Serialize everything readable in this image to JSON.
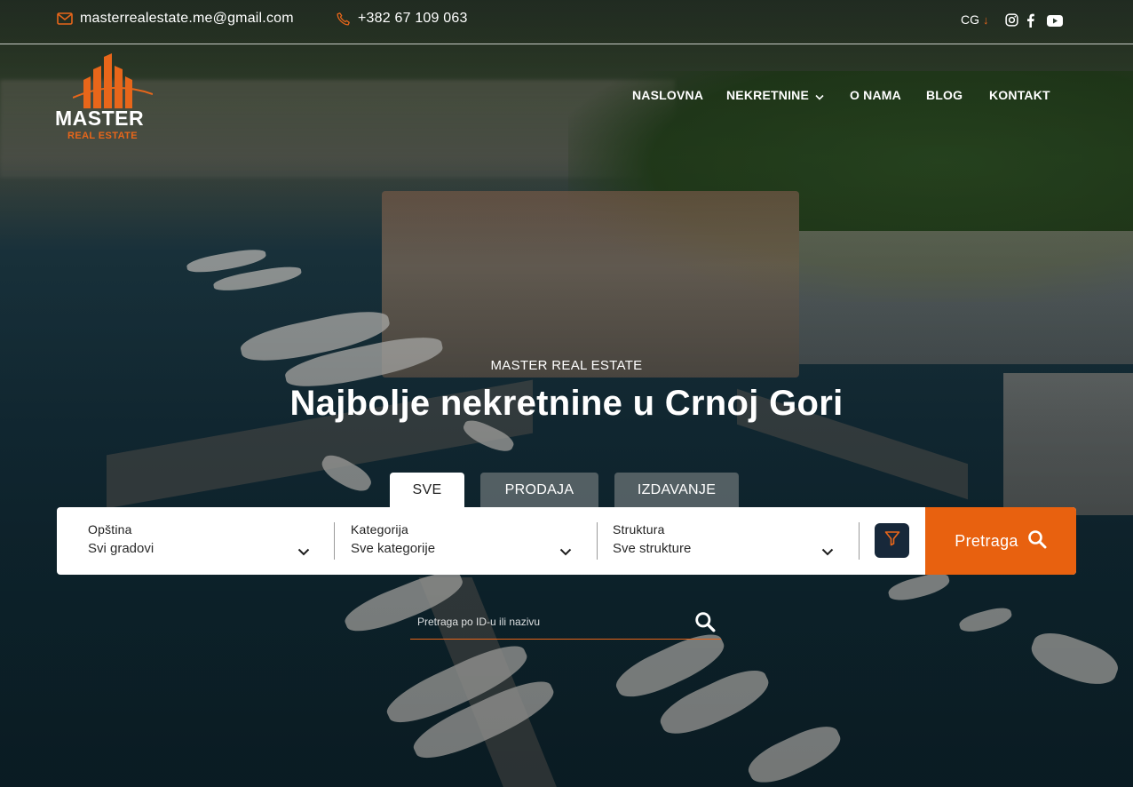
{
  "topbar": {
    "email": "masterrealestate.me@gmail.com",
    "phone": "+382 67 109 063",
    "language": "CG",
    "language_arrow": "↓",
    "icons": [
      "mail-icon",
      "phone-icon",
      "instagram-icon",
      "facebook-icon",
      "youtube-icon"
    ]
  },
  "logo": {
    "brand": "MASTER",
    "sub": "REAL ESTATE"
  },
  "nav": {
    "items": [
      {
        "label": "NASLOVNA"
      },
      {
        "label": "NEKRETNINE"
      },
      {
        "label": "O NAMA"
      },
      {
        "label": "BLOG"
      },
      {
        "label": "KONTAKT"
      }
    ]
  },
  "hero": {
    "eyebrow": "MASTER REAL ESTATE",
    "headline": "Najbolje nekretnine u Crnoj Gori"
  },
  "tabs": [
    {
      "label": "SVE",
      "active": true
    },
    {
      "label": "PRODAJA",
      "active": false
    },
    {
      "label": "IZDAVANJE",
      "active": false
    }
  ],
  "search": {
    "fields": [
      {
        "label": "Opština",
        "value": "Svi gradovi"
      },
      {
        "label": "Kategorija",
        "value": "Sve kategorije"
      },
      {
        "label": "Struktura",
        "value": "Sve strukture"
      }
    ],
    "button_label": "Pretraga",
    "id_placeholder": "Pretraga po ID-u ili nazivu"
  },
  "colors": {
    "accent": "#e8610f",
    "filter_button": "#17283a",
    "white": "#ffffff"
  }
}
